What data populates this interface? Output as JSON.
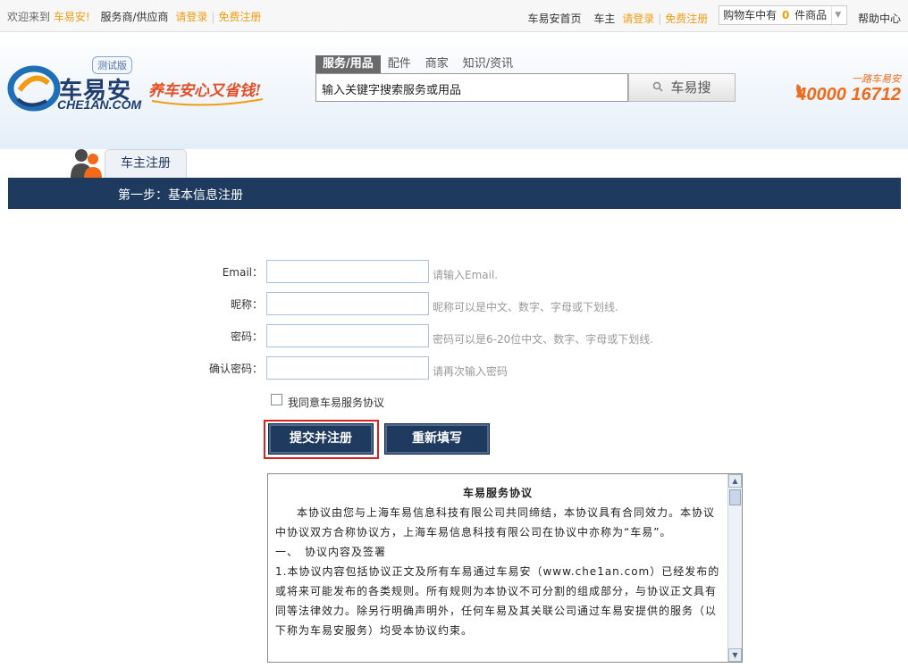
{
  "topbar": {
    "welcome": "欢迎来到",
    "brand": "车易安!",
    "provider": "服务商/供应商",
    "login": "请登录",
    "register": "免费注册",
    "home": "车易安首页",
    "owner": "车主",
    "login2": "请登录",
    "register2": "免费注册",
    "cart_prefix": "购物车中有",
    "cart_count": "0",
    "cart_suffix": "件商品",
    "help": "帮助中心"
  },
  "header": {
    "logo_cn": "车易安",
    "logo_en": "CHE1AN.COM",
    "test_badge": "测试版",
    "slogan": "养车安心又省钱!",
    "search_tabs": [
      "服务/用品",
      "配件",
      "商家",
      "知识/资讯"
    ],
    "search_placeholder": "输入关键字搜索服务或用品",
    "search_button": "车易搜",
    "hotline_small": "一路车易安",
    "hotline": "40000 16712"
  },
  "register": {
    "tab": "车主注册",
    "step": "第一步：基本信息注册",
    "fields": [
      {
        "label": "Email：",
        "hint": "请输入Email."
      },
      {
        "label": "昵称：",
        "hint": "昵称可以是中文、数字、字母或下划线."
      },
      {
        "label": "密码：",
        "hint": "密码可以是6-20位中文、数字、字母或下划线."
      },
      {
        "label": "确认密码：",
        "hint": "请再次输入密码"
      }
    ],
    "agree_label": "我同意车易服务协议",
    "submit_label": "提交并注册",
    "reset_label": "重新填写"
  },
  "agreement": {
    "title": "车易服务协议",
    "para1": "本协议由您与上海车易信息科技有限公司共同缔结，本协议具有合同效力。本协议中协议双方合称协议方，上海车易信息科技有限公司在协议中亦称为“车易”。",
    "section1": "一、　协议内容及签署",
    "para2": "1.本协议内容包括协议正文及所有车易通过车易安（www.che1an.com）已经发布的或将来可能发布的各类规则。所有规则为本协议不可分割的组成部分，与协议正文具有同等法律效力。除另行明确声明外，任何车易及其关联公司通过车易安提供的服务（以下称为车易安服务）均受本协议约束。"
  },
  "colors": {
    "brand_navy": "#1e3a5f",
    "accent_orange": "#f39c12",
    "hotline_orange": "#f06a1a",
    "highlight_red": "#d62323"
  }
}
